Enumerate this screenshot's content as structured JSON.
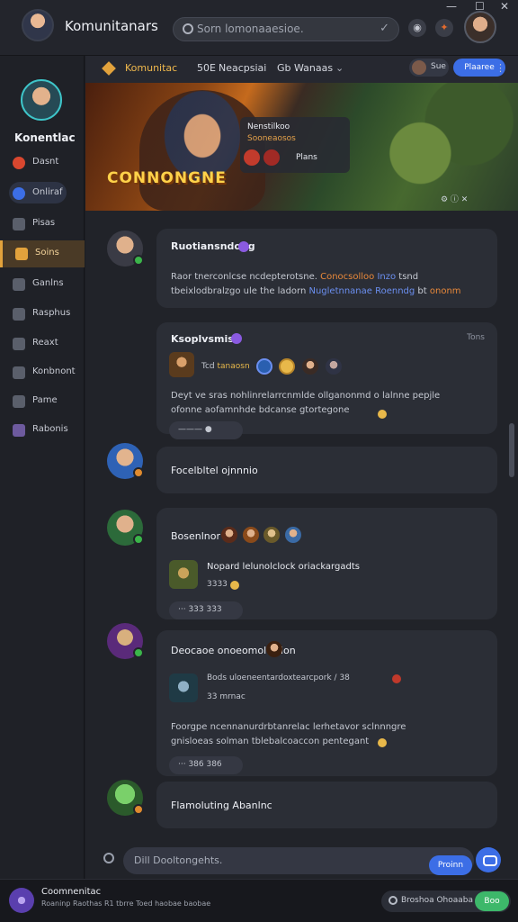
{
  "app": {
    "title": "Komunitanars",
    "window_controls": [
      "—",
      "☐",
      "✕"
    ]
  },
  "search": {
    "value": "Sorn lomonaaesioe.",
    "placeholder": "Sorn lomonaaesioe."
  },
  "sidebar": {
    "profile_name": "Konentlac",
    "items": [
      {
        "label": "Dasnt",
        "icon": "target-icon",
        "color": "#d9472f"
      },
      {
        "label": "Onliraf",
        "icon": "status-dot-icon",
        "color": "#3c6ee6"
      },
      {
        "label": "Pisas",
        "icon": "folder-icon",
        "color": "#9aa0ad"
      },
      {
        "label": "Soins",
        "icon": "game-controller-icon",
        "color": "#e2a23c"
      },
      {
        "label": "Ganlns",
        "icon": "gear-icon",
        "color": "#9aa0ad"
      },
      {
        "label": "Rasphus",
        "icon": "bookmark-icon",
        "color": "#9aa0ad"
      },
      {
        "label": "Reaxt",
        "icon": "chat-icon",
        "color": "#9aa0ad"
      },
      {
        "label": "Konbnont",
        "icon": "edit-icon",
        "color": "#9aa0ad"
      },
      {
        "label": "Pame",
        "icon": "users-icon",
        "color": "#9aa0ad"
      },
      {
        "label": "Rabonis",
        "icon": "image-icon",
        "color": "#9aa0ad"
      }
    ]
  },
  "subheader": {
    "title": "Komunitac",
    "items": [
      "50E",
      "Neacpsiai",
      "Gb",
      "Wanaas"
    ],
    "chip": "Sue",
    "button": "Plaaree"
  },
  "banner": {
    "logo_text": "CONNONGNE",
    "card_title": "Nenstilkoo",
    "card_subtitle": "Sooneaosos",
    "card_action": "Plans",
    "controls": "⚙ ⓘ ✕"
  },
  "posts": [
    {
      "title": "Ruotiansndong",
      "body_parts": [
        "Raor tnerconlcse ncdepterotsne. ",
        "Conocsolloo ",
        "Inzo",
        " tsnd tbeixlodbralzgo ule the ladorn ",
        "Nugletnnanae Roenndg",
        " bt ",
        "ononm"
      ],
      "status": "online"
    },
    {
      "title": "Ksoplvsmis",
      "time": "Tons",
      "tag_text": "Tcd",
      "tag_highlight": "tanaosn",
      "body": "Deyt ve sras nohlinrelarrcnmlde ollganonmd o lalnne pepjle ofonne aofamnhde bdcanse gtortegone",
      "reaction": "——— ●",
      "status": "none"
    },
    {
      "title": "Focelbltel ojnnnio",
      "status": "away"
    },
    {
      "title": "Bosenlnor",
      "sub_title": "Nopard lelunolclock oriackargadts",
      "sub_value": "3333",
      "reaction": "···  333  333",
      "status": "online"
    },
    {
      "title": "Deocaoe onoeomolurtion",
      "sub_title": "Bods uloeneentardoxtearcpork / 38",
      "sub_value": "33 mrnac",
      "body": "Foorgpe ncennanurdrbtanrelac lerhetavor sclnnngre gnisloeas solman tblebalcoaccon pentegant",
      "reaction": "···  386  386",
      "status": "online"
    },
    {
      "title": "Flamoluting Abanlnc",
      "status": "away"
    }
  ],
  "composer": {
    "placeholder": "Dill Dooltongehts.",
    "send_label": "Proinn"
  },
  "footer": {
    "title": "Coomnenitac",
    "subtitle": "Roaninp Raothas R1 tbrre Toed haobae baobae",
    "pill_label": "Broshoa Ohoaaba",
    "go_label": "Boo"
  },
  "colors": {
    "accent": "#3c6ee6",
    "highlight": "#e2a23c",
    "online": "#3bb54a",
    "away": "#e08b2f",
    "verified": "#8a5ae0"
  }
}
